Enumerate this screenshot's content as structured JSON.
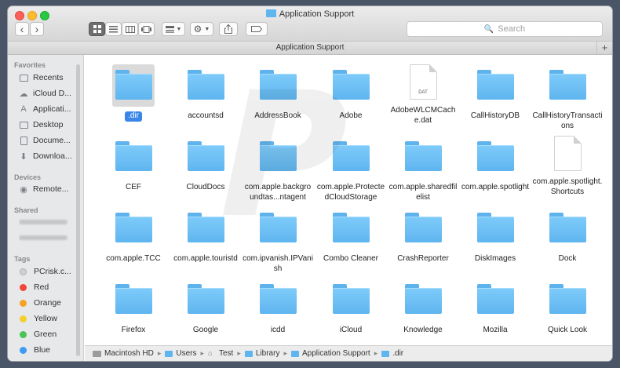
{
  "window": {
    "title": "Application Support"
  },
  "toolbar": {
    "back": "‹",
    "forward": "›",
    "search_placeholder": "Search"
  },
  "path_bar": {
    "title": "Application Support",
    "add": "+"
  },
  "sidebar": {
    "favorites_header": "Favorites",
    "favorites": [
      {
        "label": "Recents",
        "icon": "recents-icon"
      },
      {
        "label": "iCloud D...",
        "icon": "cloud-icon"
      },
      {
        "label": "Applicati...",
        "icon": "applications-icon"
      },
      {
        "label": "Desktop",
        "icon": "desktop-icon"
      },
      {
        "label": "Docume...",
        "icon": "documents-icon"
      },
      {
        "label": "Downloa...",
        "icon": "downloads-icon"
      }
    ],
    "devices_header": "Devices",
    "devices": [
      {
        "label": "Remote...",
        "icon": "disc-icon"
      }
    ],
    "shared_header": "Shared",
    "tags_header": "Tags",
    "tags": [
      {
        "label": "PCrisk.c...",
        "color": "#d0d0d0"
      },
      {
        "label": "Red",
        "color": "#f2463c"
      },
      {
        "label": "Orange",
        "color": "#f7a127"
      },
      {
        "label": "Yellow",
        "color": "#f5cf2d"
      },
      {
        "label": "Green",
        "color": "#48c454"
      },
      {
        "label": "Blue",
        "color": "#3d9bf3"
      }
    ]
  },
  "files": [
    {
      "name": ".dir",
      "type": "folder",
      "selected": true
    },
    {
      "name": "accountsd",
      "type": "folder"
    },
    {
      "name": "AddressBook",
      "type": "folder"
    },
    {
      "name": "Adobe",
      "type": "folder"
    },
    {
      "name": "AdobeWLCMCache.dat",
      "type": "doc",
      "ext": "DAT"
    },
    {
      "name": "CallHistoryDB",
      "type": "folder"
    },
    {
      "name": "CallHistoryTransactions",
      "type": "folder"
    },
    {
      "name": "CEF",
      "type": "folder"
    },
    {
      "name": "CloudDocs",
      "type": "folder"
    },
    {
      "name": "com.apple.backgroundtas...ntagent",
      "type": "folder"
    },
    {
      "name": "com.apple.ProtectedCloudStorage",
      "type": "folder"
    },
    {
      "name": "com.apple.sharedfilelist",
      "type": "folder"
    },
    {
      "name": "com.apple.spotlight",
      "type": "folder"
    },
    {
      "name": "com.apple.spotlight.Shortcuts",
      "type": "doc",
      "ext": ""
    },
    {
      "name": "com.apple.TCC",
      "type": "folder"
    },
    {
      "name": "com.apple.touristd",
      "type": "folder"
    },
    {
      "name": "com.ipvanish.IPVanish",
      "type": "folder"
    },
    {
      "name": "Combo Cleaner",
      "type": "folder"
    },
    {
      "name": "CrashReporter",
      "type": "folder"
    },
    {
      "name": "DiskImages",
      "type": "folder"
    },
    {
      "name": "Dock",
      "type": "folder"
    },
    {
      "name": "Firefox",
      "type": "folder"
    },
    {
      "name": "Google",
      "type": "folder"
    },
    {
      "name": "icdd",
      "type": "folder"
    },
    {
      "name": "iCloud",
      "type": "folder"
    },
    {
      "name": "Knowledge",
      "type": "folder"
    },
    {
      "name": "Mozilla",
      "type": "folder"
    },
    {
      "name": "Quick Look",
      "type": "folder"
    }
  ],
  "breadcrumb": [
    {
      "label": "Macintosh HD",
      "icon": "drive-icon"
    },
    {
      "label": "Users",
      "icon": "folder-icon"
    },
    {
      "label": "Test",
      "icon": "home-icon"
    },
    {
      "label": "Library",
      "icon": "folder-icon"
    },
    {
      "label": "Application Support",
      "icon": "folder-icon"
    },
    {
      "label": ".dir",
      "icon": "folder-icon"
    }
  ],
  "colors": {
    "accent": "#3a86e8",
    "folder": "#6cbff5",
    "sidebar_bg": "#e7e8ea"
  }
}
